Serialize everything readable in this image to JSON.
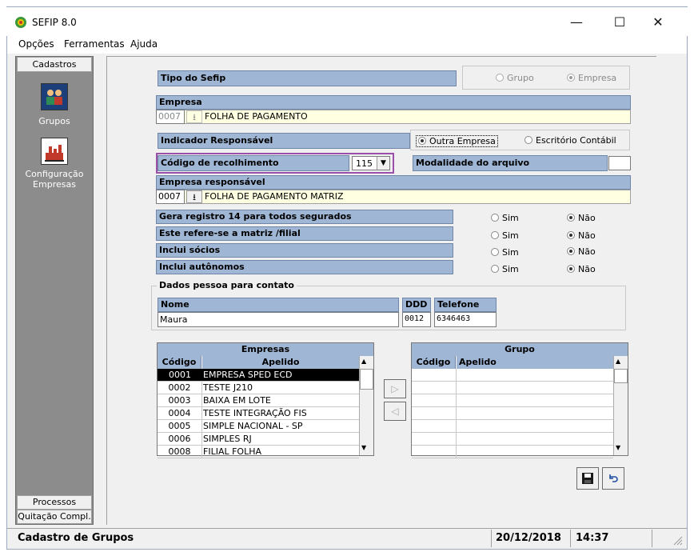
{
  "window": {
    "title": "SEFIP 8.0",
    "minimize": "—",
    "maximize": "☐",
    "close": "✕"
  },
  "menu": {
    "opcoes": "Opções",
    "ferramentas": "Ferramentas",
    "ajuda": "Ajuda"
  },
  "sidebar": {
    "header": "Cadastros",
    "items": [
      {
        "label": "Grupos",
        "icon": "groups-icon"
      },
      {
        "label": "Configuração Empresas",
        "label_line1": "Configuração",
        "label_line2": "Empresas",
        "icon": "company-config-icon"
      }
    ],
    "footer1": "Processos",
    "footer2": "Quitação Compl."
  },
  "form": {
    "tipo_label": "Tipo do Sefip",
    "tipo_options": [
      {
        "label": "Grupo",
        "selected": false
      },
      {
        "label": "Empresa",
        "selected": true
      }
    ],
    "empresa_label": "Empresa",
    "empresa_code": "0007",
    "empresa_name": "FOLHA DE PAGAMENTO",
    "indicador_label": "Indicador Responsável",
    "indicador_options": [
      {
        "label": "Outra Empresa",
        "selected": true
      },
      {
        "label": "Escritório Contábil",
        "selected": false
      }
    ],
    "codigo_label": "Código de recolhimento",
    "codigo_value": "115",
    "modalidade_label": "Modalidade do arquivo",
    "modalidade_value": "",
    "empresa_resp_label": "Empresa responsável",
    "empresa_resp_code": "0007",
    "empresa_resp_name": "FOLHA DE PAGAMENTO MATRIZ",
    "questions": [
      {
        "label": "Gera registro 14 para todos segurados",
        "sim": "Sim",
        "nao": "Não",
        "value": "nao"
      },
      {
        "label": "Este refere-se a matriz /filial",
        "sim": "Sim",
        "nao": "Não",
        "value": "nao"
      },
      {
        "label": "Inclui sócios",
        "sim": "Sim",
        "nao": "Não",
        "value": "nao"
      },
      {
        "label": "Inclui autônomos",
        "sim": "Sim",
        "nao": "Não",
        "value": "nao"
      }
    ],
    "contato_legend": "Dados pessoa para contato",
    "nome_label": "Nome",
    "nome_value": "Maura",
    "ddd_label": "DDD",
    "ddd_value": "0012",
    "telefone_label": "Telefone",
    "telefone_value": "6346463"
  },
  "empresas_table": {
    "title": "Empresas",
    "col_codigo": "Código",
    "col_apelido": "Apelido",
    "rows": [
      {
        "codigo": "0001",
        "apelido": "EMPRESA SPED ECD",
        "selected": true
      },
      {
        "codigo": "0002",
        "apelido": "TESTE J210"
      },
      {
        "codigo": "0003",
        "apelido": "BAIXA EM LOTE"
      },
      {
        "codigo": "0004",
        "apelido": "TESTE INTEGRAÇÃO FIS"
      },
      {
        "codigo": "0005",
        "apelido": "SIMPLE NACIONAL - SP"
      },
      {
        "codigo": "0006",
        "apelido": "SIMPLES RJ"
      },
      {
        "codigo": "0008",
        "apelido": "FILIAL FOLHA"
      }
    ]
  },
  "grupo_table": {
    "title": "Grupo",
    "col_codigo": "Código",
    "col_apelido": "Apelido"
  },
  "status": {
    "text": "Cadastro de Grupos",
    "date": "20/12/2018",
    "time": "14:37"
  }
}
